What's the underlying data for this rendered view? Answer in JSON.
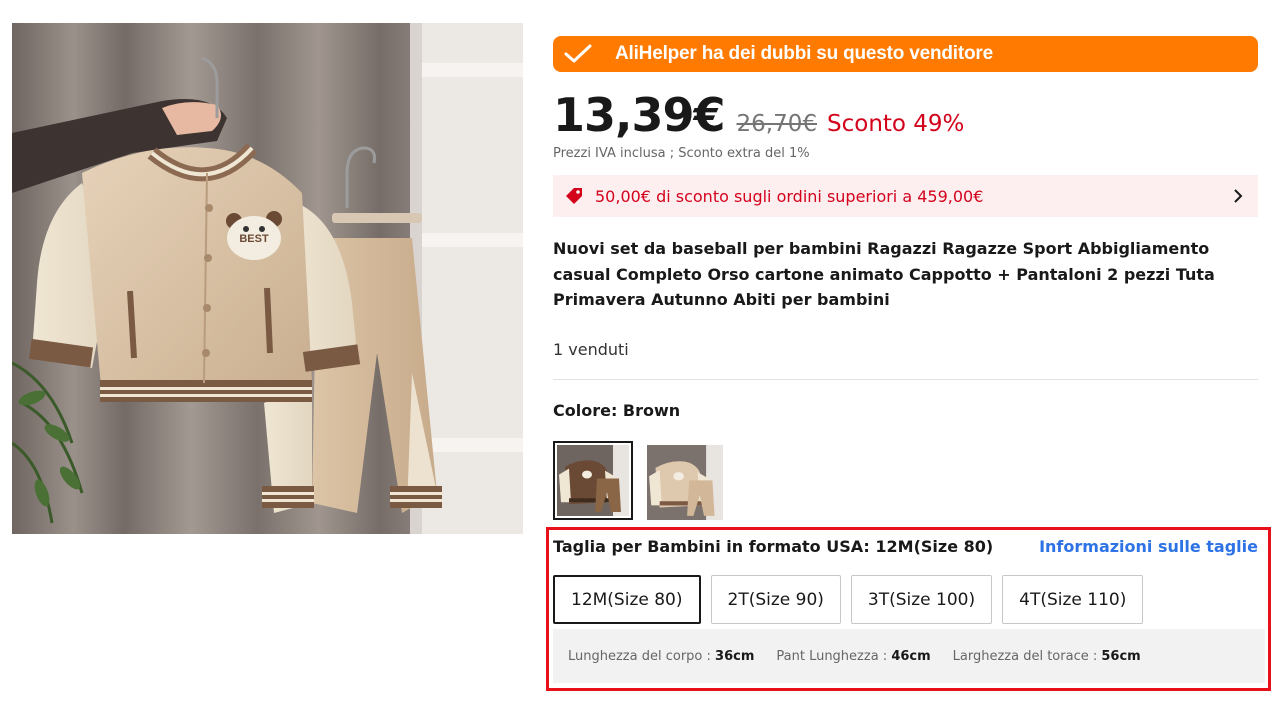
{
  "alihelper": {
    "message": "AliHelper ha dei dubbi su questo venditore",
    "icon": "check-icon",
    "color": "#ff7a00"
  },
  "price": {
    "current": "13,39€",
    "original": "26,70€",
    "discount": "Sconto 49%",
    "note": "Prezzi IVA inclusa ; Sconto extra del 1%",
    "discount_color": "#d3031c"
  },
  "coupon": {
    "text": "50,00€ di sconto sugli ordini superiori a 459,00€",
    "icon": "coupon-tag-icon"
  },
  "product": {
    "title": "Nuovi set da baseball per bambini Ragazzi Ragazze Sport Abbigliamento casual Completo Orso cartone animato Cappotto + Pantaloni 2 pezzi Tuta Primavera Autunno Abiti per bambini",
    "sold": "1 venduti",
    "badge_text": "BEST"
  },
  "color": {
    "label": "Colore: Brown",
    "options": [
      "Brown",
      "Beige"
    ]
  },
  "size": {
    "label": "Taglia per Bambini in formato USA: 12M(Size 80)",
    "guide_link": "Informazioni sulle taglie",
    "options": [
      "12M(Size 80)",
      "2T(Size 90)",
      "3T(Size 100)",
      "4T(Size 110)"
    ],
    "selected": "12M(Size 80)",
    "link_color": "#2d73e6"
  },
  "measurements": [
    {
      "label": "Lunghezza del corpo : ",
      "value": "36cm"
    },
    {
      "label": "Pant Lunghezza : ",
      "value": "46cm"
    },
    {
      "label": "Larghezza del torace : ",
      "value": "56cm"
    }
  ]
}
